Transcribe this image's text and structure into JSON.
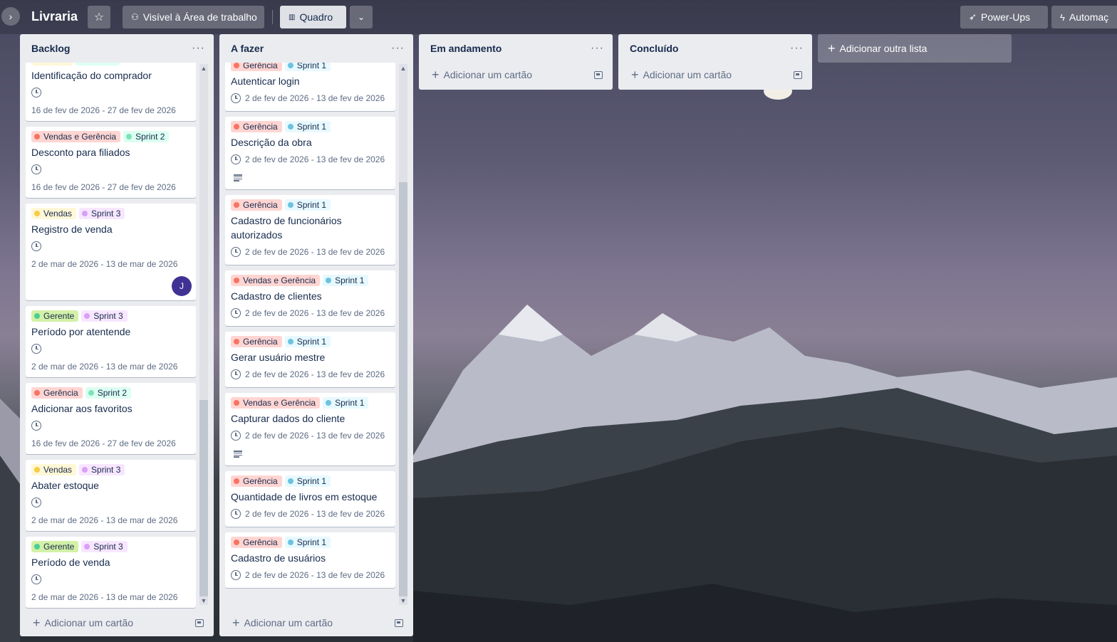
{
  "header": {
    "board_title": "Livraria",
    "visibility_label": "Visível à Área de trabalho",
    "view_label": "Quadro",
    "powerups_label": "Power-Ups",
    "automation_label": "Automaç"
  },
  "colors": {
    "gerencia": "#f87462",
    "gerencia_bg": "#ffd5d2",
    "vendas": "#f5cd47",
    "vendas_bg": "#fff7d6",
    "gerente": "#4bce97",
    "gerente_bg": "#d3f1a7",
    "sprint1": "#6cc3e0",
    "sprint1_bg": "#e7f9ff",
    "sprint2": "#7ee2b8",
    "sprint2_bg": "#dcfff1",
    "sprint3": "#d8a0f7",
    "sprint3_bg": "#f8e6ff"
  },
  "lists": [
    {
      "title": "Backlog",
      "add_card": "Adicionar um cartão",
      "cards": [
        {
          "labels": [
            {
              "text": "",
              "color": "vendas"
            },
            {
              "text": "",
              "color": "sprint2"
            }
          ],
          "title": "Identificação do comprador",
          "date": "16 de fev de 2026 - 27 de fev de 2026",
          "desc": false,
          "avatar": ""
        },
        {
          "labels": [
            {
              "text": "Vendas e Gerência",
              "color": "gerencia"
            },
            {
              "text": "Sprint 2",
              "color": "sprint2"
            }
          ],
          "title": "Desconto para filiados",
          "date": "16 de fev de 2026 - 27 de fev de 2026",
          "desc": false,
          "avatar": ""
        },
        {
          "labels": [
            {
              "text": "Vendas",
              "color": "vendas"
            },
            {
              "text": "Sprint 3",
              "color": "sprint3"
            }
          ],
          "title": "Registro de venda",
          "date": "2 de mar de 2026 - 13 de mar de 2026",
          "desc": false,
          "avatar": "J"
        },
        {
          "labels": [
            {
              "text": "Gerente",
              "color": "gerente"
            },
            {
              "text": "Sprint 3",
              "color": "sprint3"
            }
          ],
          "title": "Período por atentende",
          "date": "2 de mar de 2026 - 13 de mar de 2026",
          "desc": false,
          "avatar": ""
        },
        {
          "labels": [
            {
              "text": "Gerência",
              "color": "gerencia"
            },
            {
              "text": "Sprint 2",
              "color": "sprint2"
            }
          ],
          "title": "Adicionar aos favoritos",
          "date": "16 de fev de 2026 - 27 de fev de 2026",
          "desc": false,
          "avatar": ""
        },
        {
          "labels": [
            {
              "text": "Vendas",
              "color": "vendas"
            },
            {
              "text": "Sprint 3",
              "color": "sprint3"
            }
          ],
          "title": "Abater estoque",
          "date": "2 de mar de 2026 - 13 de mar de 2026",
          "desc": false,
          "avatar": ""
        },
        {
          "labels": [
            {
              "text": "Gerente",
              "color": "gerente"
            },
            {
              "text": "Sprint 3",
              "color": "sprint3"
            }
          ],
          "title": "Período de venda",
          "date": "2 de mar de 2026 - 13 de mar de 2026",
          "desc": false,
          "avatar": ""
        }
      ]
    },
    {
      "title": "A fazer",
      "add_card": "Adicionar um cartão",
      "cards": [
        {
          "labels": [
            {
              "text": "Gerência",
              "color": "gerencia"
            },
            {
              "text": "Sprint 1",
              "color": "sprint1"
            }
          ],
          "title": "Autenticar login",
          "date": "2 de fev de 2026 - 13 de fev de 2026",
          "desc": false,
          "avatar": ""
        },
        {
          "labels": [
            {
              "text": "Gerência",
              "color": "gerencia"
            },
            {
              "text": "Sprint 1",
              "color": "sprint1"
            }
          ],
          "title": "Descrição da obra",
          "date": "2 de fev de 2026 - 13 de fev de 2026",
          "desc": true,
          "avatar": ""
        },
        {
          "labels": [
            {
              "text": "Gerência",
              "color": "gerencia"
            },
            {
              "text": "Sprint 1",
              "color": "sprint1"
            }
          ],
          "title": "Cadastro de funcionários autorizados",
          "date": "2 de fev de 2026 - 13 de fev de 2026",
          "desc": false,
          "avatar": ""
        },
        {
          "labels": [
            {
              "text": "Vendas e Gerência",
              "color": "gerencia"
            },
            {
              "text": "Sprint 1",
              "color": "sprint1"
            }
          ],
          "title": "Cadastro de clientes",
          "date": "2 de fev de 2026 - 13 de fev de 2026",
          "desc": false,
          "avatar": ""
        },
        {
          "labels": [
            {
              "text": "Gerência",
              "color": "gerencia"
            },
            {
              "text": "Sprint 1",
              "color": "sprint1"
            }
          ],
          "title": "Gerar usuário mestre",
          "date": "2 de fev de 2026 - 13 de fev de 2026",
          "desc": false,
          "avatar": ""
        },
        {
          "labels": [
            {
              "text": "Vendas e Gerência",
              "color": "gerencia"
            },
            {
              "text": "Sprint 1",
              "color": "sprint1"
            }
          ],
          "title": "Capturar dados do cliente",
          "date": "2 de fev de 2026 - 13 de fev de 2026",
          "desc": true,
          "avatar": ""
        },
        {
          "labels": [
            {
              "text": "Gerência",
              "color": "gerencia"
            },
            {
              "text": "Sprint 1",
              "color": "sprint1"
            }
          ],
          "title": "Quantidade de livros em estoque",
          "date": "2 de fev de 2026 - 13 de fev de 2026",
          "desc": false,
          "avatar": ""
        },
        {
          "labels": [
            {
              "text": "Gerência",
              "color": "gerencia"
            },
            {
              "text": "Sprint 1",
              "color": "sprint1"
            }
          ],
          "title": "Cadastro de usuários",
          "date": "2 de fev de 2026 - 13 de fev de 2026",
          "desc": false,
          "avatar": ""
        }
      ]
    },
    {
      "title": "Em andamento",
      "add_card": "Adicionar um cartão",
      "cards": []
    },
    {
      "title": "Concluído",
      "add_card": "Adicionar um cartão",
      "cards": []
    }
  ],
  "add_list_label": "Adicionar outra lista"
}
